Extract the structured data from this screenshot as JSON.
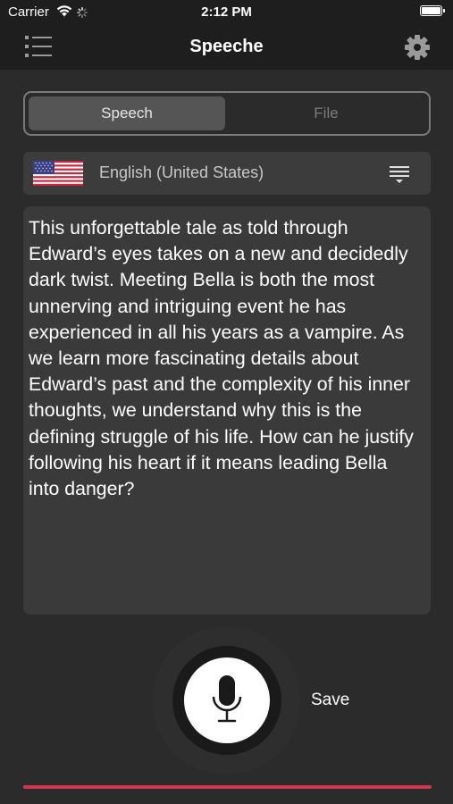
{
  "status_bar": {
    "carrier": "Carrier",
    "time": "2:12 PM",
    "icons": [
      "wifi-icon",
      "activity-spinner-icon",
      "battery-icon"
    ]
  },
  "nav_bar": {
    "title": "Speeche",
    "left_icon": "list-menu-icon",
    "right_icon": "gear-icon"
  },
  "mode_tabs": {
    "items": [
      {
        "label": "Speech",
        "selected": true
      },
      {
        "label": "File",
        "selected": false
      }
    ]
  },
  "language": {
    "flag_icon": "us-flag-icon",
    "name": "English (United States)",
    "menu_icon": "lines-dropdown-icon"
  },
  "transcript": {
    "text": "This unforgettable tale as told through Edward’s eyes takes on a new and decidedly dark twist. Meeting Bella is both the most unnerving and intriguing event he has experienced in all his years as a vampire. As we learn more fascinating details about Edward’s past and the complexity of his inner thoughts, we understand why this is the defining struggle of his life. How can he justify following his heart if it means leading Bella into danger?"
  },
  "controls": {
    "mic_icon": "microphone-icon",
    "save_label": "Save"
  },
  "colors": {
    "background": "#2b2b2b",
    "bar": "#1e1e1e",
    "accent_line": "#d2364e",
    "text": "#ffffff"
  }
}
